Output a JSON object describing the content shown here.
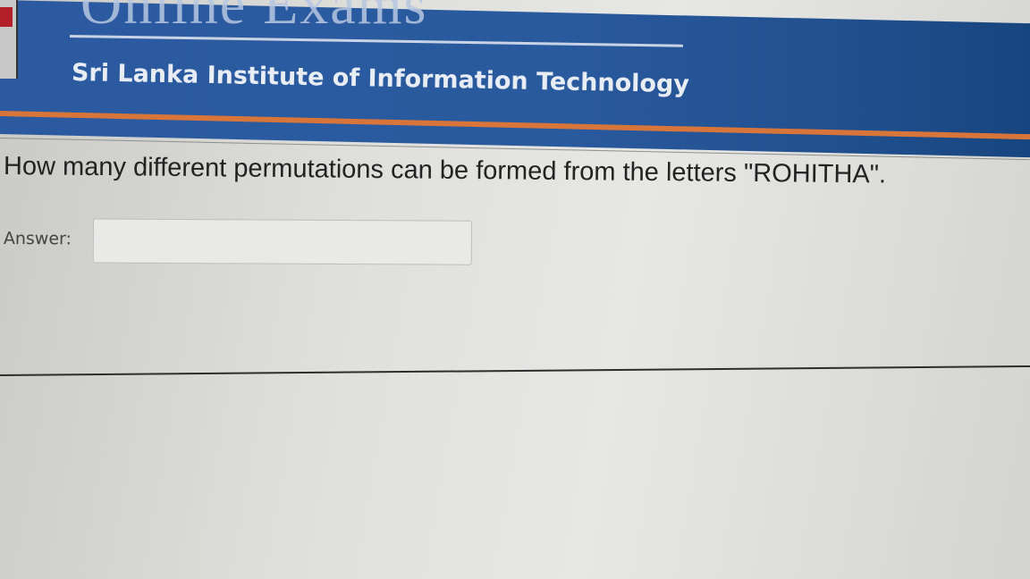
{
  "header": {
    "site_title": "Online Exams",
    "institute": "Sri Lanka Institute of Information Technology"
  },
  "question": {
    "text": "How many different permutations can be formed from the letters \"ROHITHA\".",
    "answer_label": "Answer:",
    "answer_value": ""
  },
  "colors": {
    "header_blue": "#2b5aa0",
    "accent_orange": "#d8753a",
    "logo_red": "#b3202a"
  }
}
